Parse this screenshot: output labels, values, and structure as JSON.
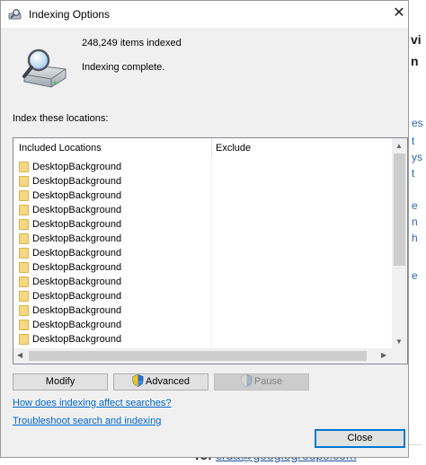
{
  "window": {
    "title": "Indexing Options",
    "close_glyph": "✕"
  },
  "summary": {
    "items_indexed": "248,249 items indexed",
    "status": "Indexing complete."
  },
  "locations": {
    "label": "Index these locations:",
    "columns": {
      "included": "Included Locations",
      "exclude": "Exclude"
    },
    "rows": [
      "DesktopBackground",
      "DesktopBackground",
      "DesktopBackground",
      "DesktopBackground",
      "DesktopBackground",
      "DesktopBackground",
      "DesktopBackground",
      "DesktopBackground",
      "DesktopBackground",
      "DesktopBackground",
      "DesktopBackground",
      "DesktopBackground",
      "DesktopBackground"
    ]
  },
  "buttons": {
    "modify": "Modify",
    "advanced": "Advanced",
    "pause": "Pause",
    "close": "Close"
  },
  "links": {
    "help": "How does indexing affect searches?",
    "troubleshoot": "Troubleshoot search and indexing"
  },
  "background": {
    "to_label": "To:",
    "to_address": "crda@googlegroups.com"
  }
}
